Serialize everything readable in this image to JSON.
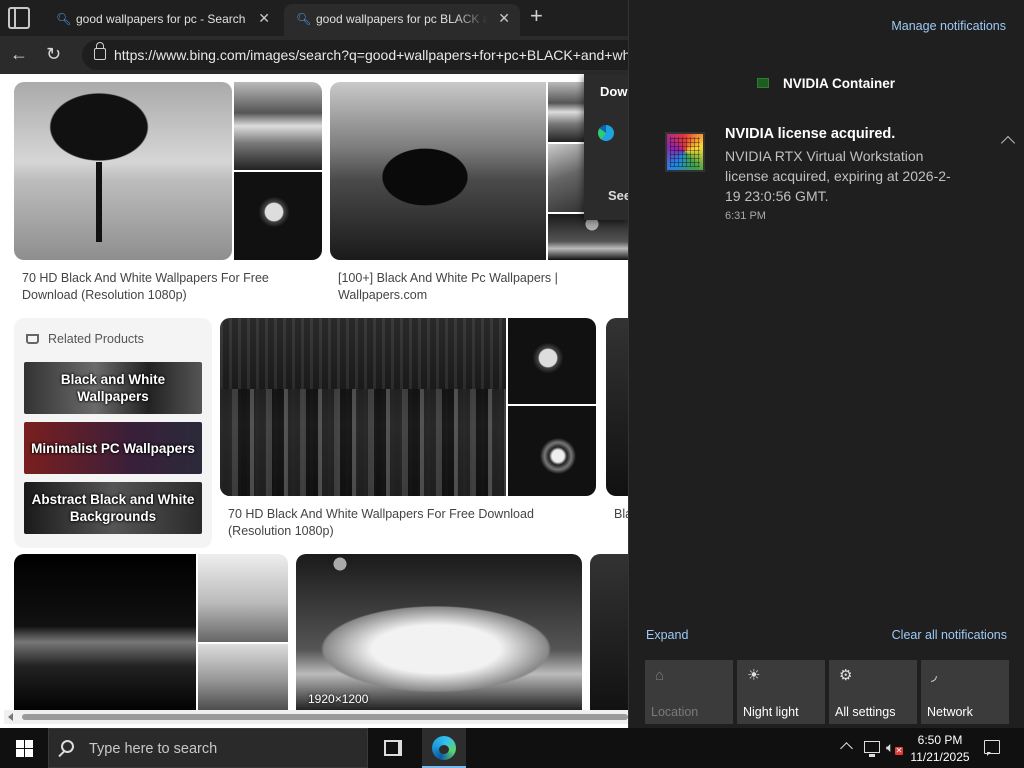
{
  "browser": {
    "tabs": [
      {
        "title": "good wallpapers for pc - Search",
        "icon": "bing-search-icon"
      },
      {
        "title": "good wallpapers for pc BLACK and white - Search",
        "icon": "bing-search-icon"
      }
    ],
    "address": "https://www.bing.com/images/search?q=good+wallpapers+for+pc+BLACK+and+white",
    "results": {
      "captions": [
        "70 HD Black And White Wallpapers For Free Download (Resolution 1080p)",
        "[100+] Black And White Pc Wallpapers | Wallpapers.com",
        "70 HD Black And White Wallpapers For Free Download (Resolution 1080p)",
        "Bla",
        "1920×1200"
      ]
    },
    "related": {
      "title": "Related Products",
      "items": [
        "Black and White Wallpapers",
        "Minimalist PC Wallpapers",
        "Abstract Black and White Backgrounds"
      ]
    },
    "flyout": {
      "title": "Dow",
      "see": "See"
    }
  },
  "action_center": {
    "manage": "Manage notifications",
    "group_title": "NVIDIA Container",
    "notification": {
      "title": "NVIDIA license acquired.",
      "body": "NVIDIA RTX Virtual Workstation license acquired, expiring at 2026-2-19 23:0:56 GMT.",
      "time": "6:31 PM"
    },
    "expand": "Expand",
    "clear_all": "Clear all notifications",
    "quick_actions": [
      {
        "label": "Location",
        "icon": "location-icon",
        "enabled": false
      },
      {
        "label": "Night light",
        "icon": "sun-icon",
        "enabled": true
      },
      {
        "label": "All settings",
        "icon": "gear-icon",
        "enabled": true
      },
      {
        "label": "Network",
        "icon": "wifi-icon",
        "enabled": true
      }
    ]
  },
  "taskbar": {
    "search_placeholder": "Type here to search",
    "time": "6:50 PM",
    "date": "11/21/2025"
  }
}
